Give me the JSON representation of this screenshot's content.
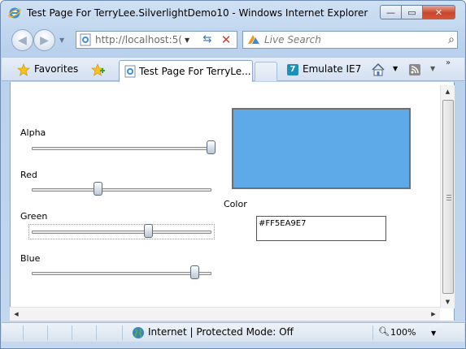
{
  "window": {
    "title": "Test Page For TerryLee.SilverlightDemo10 - Windows Internet Explorer",
    "minimize_glyph": "—",
    "maximize_glyph": "▭",
    "close_glyph": "✕"
  },
  "address_bar": {
    "url": "http://localhost:5(",
    "search_placeholder": "Live Search"
  },
  "toolbar": {
    "favorites_label": "Favorites",
    "tab_label": "Test Page For TerryLe...",
    "emulate_label": "Emulate IE7",
    "emulate_glyph": "7"
  },
  "page": {
    "sliders": [
      {
        "label": "Alpha",
        "value": 1.0
      },
      {
        "label": "Red",
        "value": 0.37
      },
      {
        "label": "Green",
        "value": 0.65
      },
      {
        "label": "Blue",
        "value": 0.91
      }
    ],
    "color_label": "Color",
    "hex_value": "#FF5EA9E7",
    "swatch_color": "#5EA9E7"
  },
  "status_bar": {
    "zone": "Internet | Protected Mode: Off",
    "zoom": "100%"
  },
  "colors": {
    "accent": "#2f6fb7",
    "close_button": "#c9462c"
  }
}
